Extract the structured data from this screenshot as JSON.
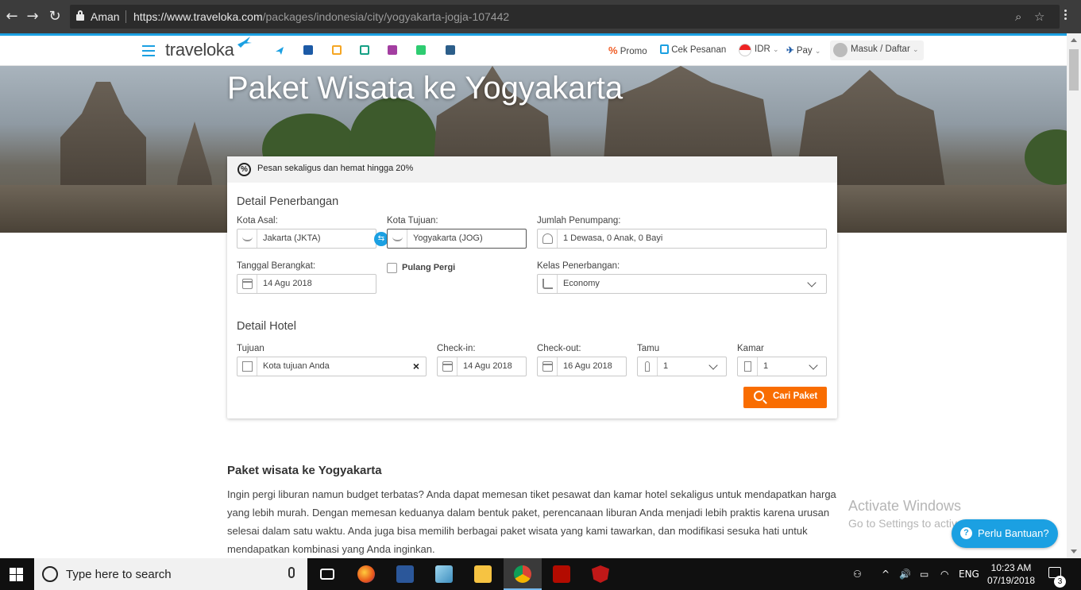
{
  "browser": {
    "secure_label": "Aman",
    "url_host": "https://www.traveloka.com",
    "url_path": "/packages/indonesia/city/yogyakarta-jogja-107442",
    "icons": [
      "back-icon",
      "forward-icon",
      "reload-icon",
      "lock-icon",
      "zoom-icon",
      "star-icon",
      "menu-icon"
    ]
  },
  "header": {
    "logo": "traveloka",
    "promo": "Promo",
    "cek_pesanan": "Cek Pesanan",
    "currency": "IDR",
    "pay": "Pay",
    "login": "Masuk / Daftar",
    "product_icons": [
      "flight-icon",
      "hotel-icon",
      "train-icon",
      "bus-icon",
      "activities-icon",
      "connectivity-icon",
      "insurance-icon"
    ],
    "colors": {
      "brand": "#1ba0e2",
      "accent": "#f96d01"
    }
  },
  "hero": {
    "title": "Paket Wisata ke Yogyakarta"
  },
  "search": {
    "promo_text": "Pesan sekaligus dan hemat hingga 20%",
    "flight_title": "Detail Penerbangan",
    "origin_label": "Kota Asal:",
    "origin_value": "Jakarta (JKTA)",
    "dest_label": "Kota Tujuan:",
    "dest_value": "Yogyakarta (JOG)",
    "pax_label": "Jumlah Penumpang:",
    "pax_value": "1 Dewasa, 0 Anak, 0 Bayi",
    "depart_label": "Tanggal Berangkat:",
    "depart_value": "14 Agu 2018",
    "roundtrip_label": "Pulang Pergi",
    "class_label": "Kelas Penerbangan:",
    "class_value": "Economy",
    "hotel_title": "Detail Hotel",
    "hotel_dest_label": "Tujuan",
    "hotel_dest_placeholder": "Kota tujuan Anda",
    "checkin_label": "Check-in:",
    "checkin_value": "14 Agu 2018",
    "checkout_label": "Check-out:",
    "checkout_value": "16 Agu 2018",
    "guests_label": "Tamu",
    "guests_value": "1",
    "rooms_label": "Kamar",
    "rooms_value": "1",
    "cta": "Cari Paket"
  },
  "content": {
    "title": "Paket wisata ke Yogyakarta",
    "paragraph": "Ingin pergi liburan namun budget terbatas? Anda dapat memesan tiket pesawat dan kamar hotel sekaligus untuk mendapatkan harga yang lebih murah. Dengan memesan keduanya dalam bentuk paket, perencanaan liburan Anda menjadi lebih praktis karena urusan selesai dalam satu waktu. Anda juga bisa memilih berbagai paket wisata yang kami tawarkan, dan modifikasi sesuka hati untuk mendapatkan kombinasi yang Anda inginkan."
  },
  "watermark": {
    "line1": "Activate Windows",
    "line2": "Go to Settings to activate Windows."
  },
  "help": {
    "label": "Perlu Bantuan?"
  },
  "taskbar": {
    "search_placeholder": "Type here to search",
    "language": "ENG",
    "time": "10:23 AM",
    "date": "07/19/2018",
    "notifications": "3",
    "apps": [
      "task-view-icon",
      "firefox-icon",
      "word-icon",
      "notepad-icon",
      "file-explorer-icon",
      "chrome-icon",
      "acrobat-icon",
      "mcafee-icon"
    ]
  }
}
